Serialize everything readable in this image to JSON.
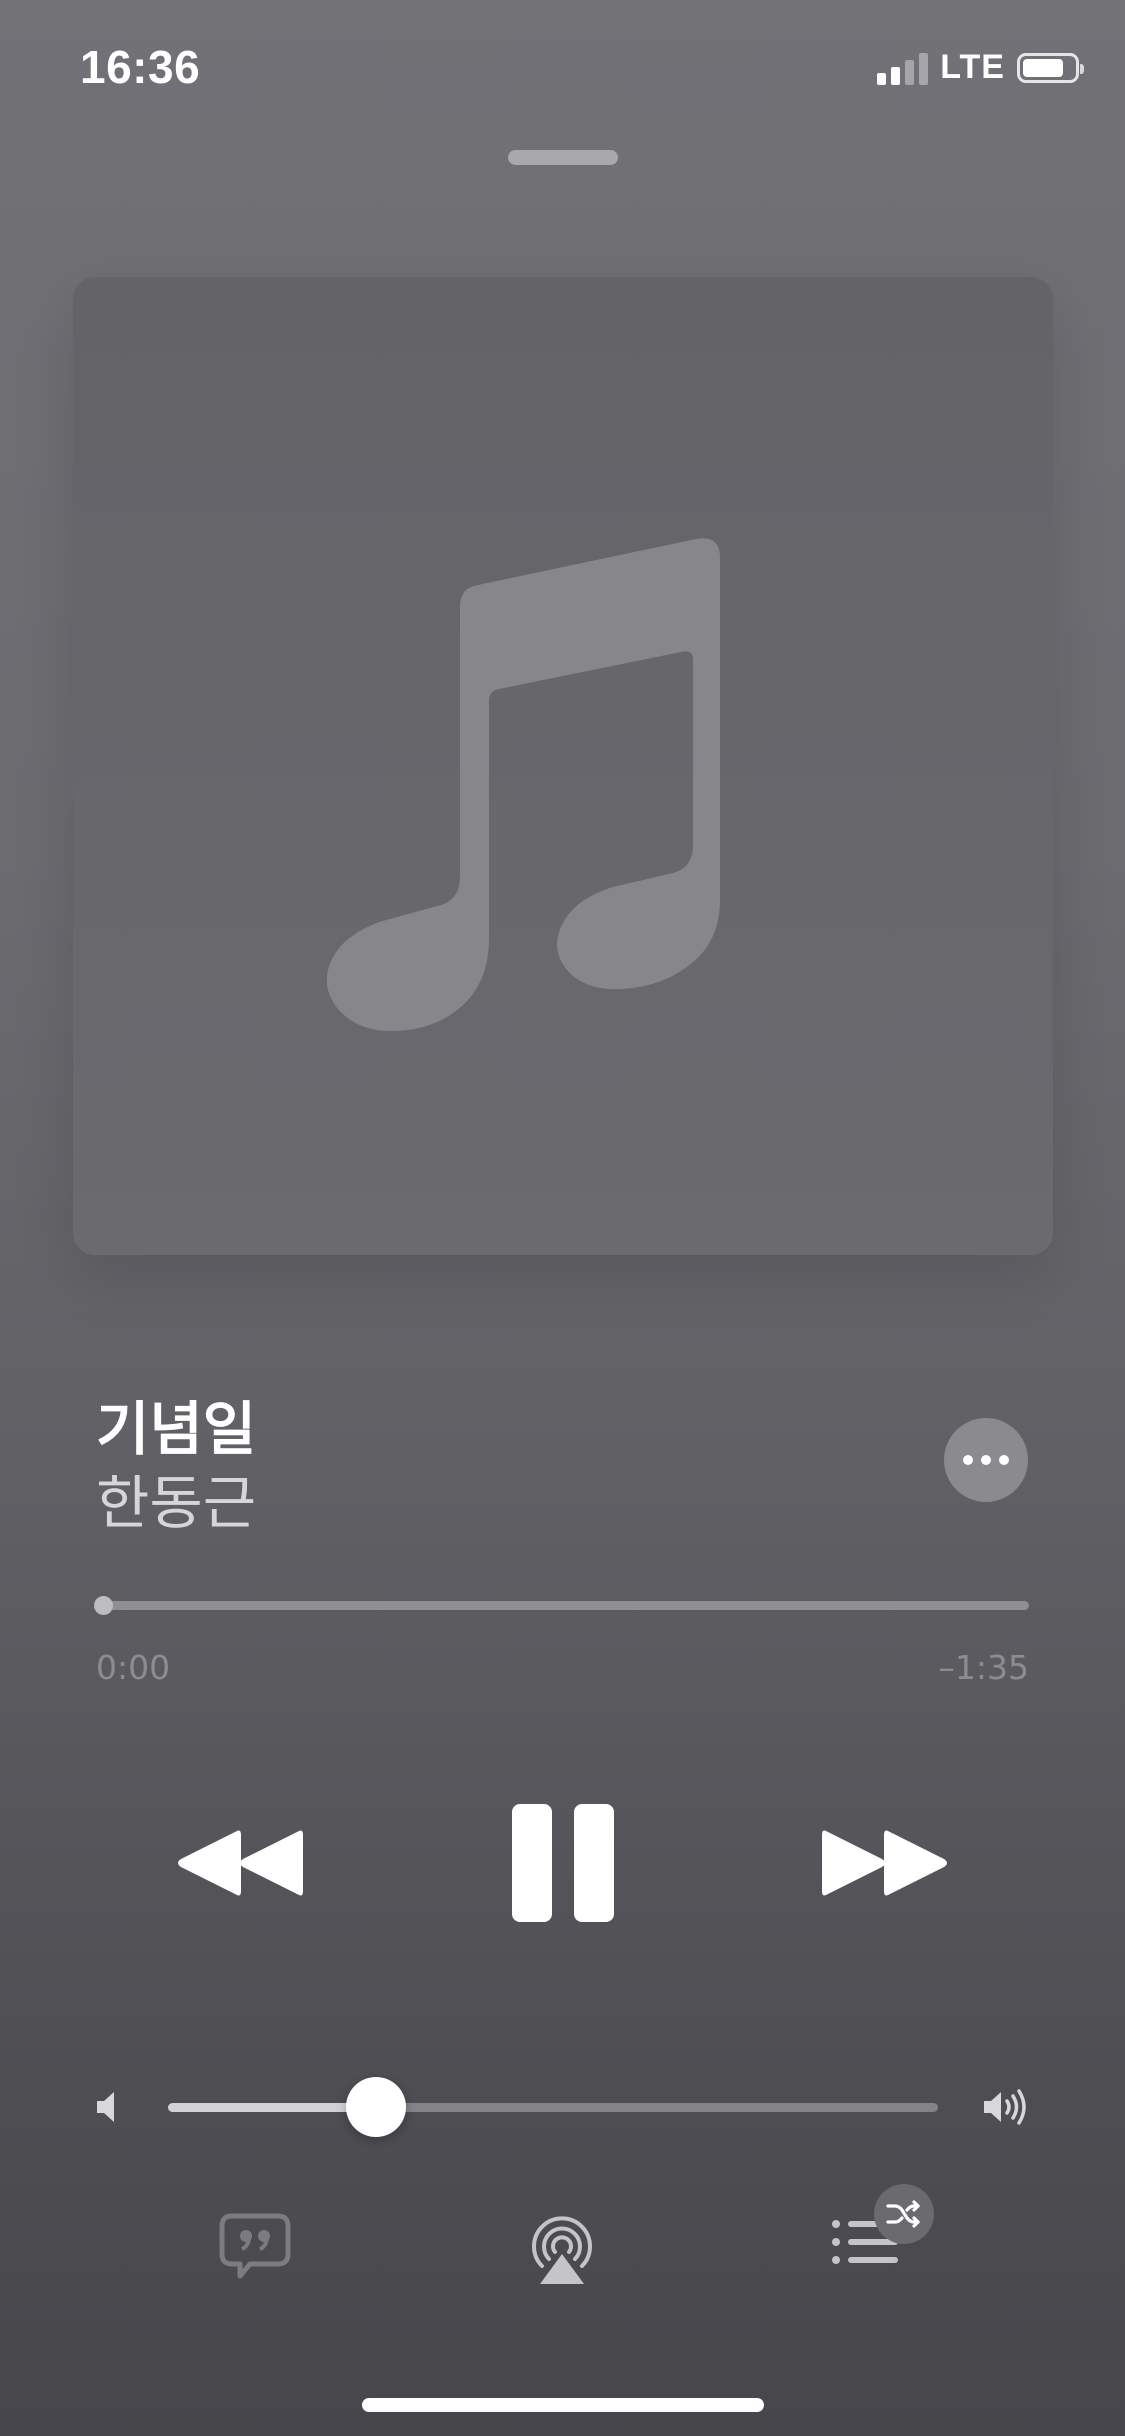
{
  "status_bar": {
    "time": "16:36",
    "network": "LTE",
    "signal_bars_active": 2,
    "signal_bars_total": 4,
    "battery_level": 0.8
  },
  "now_playing": {
    "title": "기념일",
    "artist": "한동근",
    "elapsed": "0:00",
    "remaining": "–1:35",
    "progress": 0.0,
    "volume": 0.27,
    "is_playing": true
  },
  "icons": {
    "artwork_placeholder": "music-note-icon",
    "more": "ellipsis-icon",
    "rewind": "rewind-icon",
    "pause": "pause-icon",
    "forward": "fast-forward-icon",
    "volume_low": "speaker-icon",
    "volume_high": "speaker-wave-icon",
    "lyrics": "lyrics-quote-bubble-icon",
    "airplay": "airplay-icon",
    "queue": "list-icon",
    "shuffle": "shuffle-icon"
  },
  "colors": {
    "background_top": "#717176",
    "background_bottom": "#46464b",
    "artwork_bg": "#66666b",
    "note_color": "#86868b",
    "primary_text": "#ffffff",
    "secondary_text": "#d6d6da",
    "muted_text": "#8c8c91"
  }
}
